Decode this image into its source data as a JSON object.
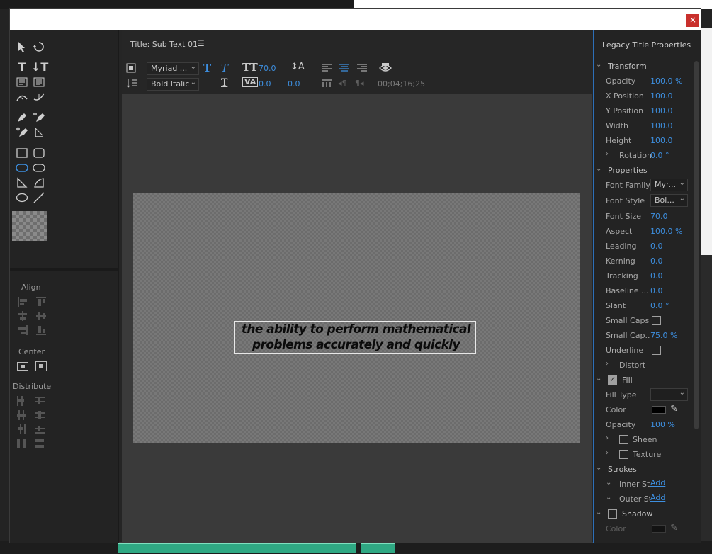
{
  "window": {
    "close_label": "×"
  },
  "main": {
    "title": "Title: Sub Text 01",
    "menu_icon": "hamburger-menu-icon",
    "toolbar": {
      "font_family": "Myriad ...",
      "font_style": "Bold Italic",
      "font_size": "70.0",
      "kerning": "0.0",
      "leading": "0.0",
      "timecode": "00;04;16;25"
    },
    "caption_lines": [
      "the ability to perform mathematical",
      "problems accurately and quickly"
    ]
  },
  "align_panel": {
    "align_label": "Align",
    "center_label": "Center",
    "distribute_label": "Distribute"
  },
  "properties": {
    "panel_title": "Legacy Title Properties",
    "transform": {
      "label": "Transform",
      "opacity": {
        "label": "Opacity",
        "value": "100.0",
        "unit": "%"
      },
      "x_position": {
        "label": "X Position",
        "value": "100.0"
      },
      "y_position": {
        "label": "Y Position",
        "value": "100.0"
      },
      "width": {
        "label": "Width",
        "value": "100.0"
      },
      "height": {
        "label": "Height",
        "value": "100.0"
      },
      "rotation": {
        "label": "Rotation",
        "value": "0.0 °"
      }
    },
    "props": {
      "label": "Properties",
      "font_family": {
        "label": "Font Family",
        "value": "Myr..."
      },
      "font_style": {
        "label": "Font Style",
        "value": "Bol..."
      },
      "font_size": {
        "label": "Font Size",
        "value": "70.0"
      },
      "aspect": {
        "label": "Aspect",
        "value": "100.0",
        "unit": "%"
      },
      "leading": {
        "label": "Leading",
        "value": "0.0"
      },
      "kerning": {
        "label": "Kerning",
        "value": "0.0"
      },
      "tracking": {
        "label": "Tracking",
        "value": "0.0"
      },
      "baseline": {
        "label": "Baseline ...",
        "value": "0.0"
      },
      "slant": {
        "label": "Slant",
        "value": "0.0 °"
      },
      "small_caps": {
        "label": "Small Caps"
      },
      "small_caps_size": {
        "label": "Small Cap...",
        "value": "75.0",
        "unit": "%"
      },
      "underline": {
        "label": "Underline"
      },
      "distort": {
        "label": "Distort"
      }
    },
    "fill": {
      "label": "Fill",
      "fill_type": {
        "label": "Fill Type",
        "value": ""
      },
      "color": {
        "label": "Color",
        "value": "#000000"
      },
      "opacity": {
        "label": "Opacity",
        "value": "100",
        "unit": "%"
      },
      "sheen": {
        "label": "Sheen"
      },
      "texture": {
        "label": "Texture"
      }
    },
    "strokes": {
      "label": "Strokes",
      "inner": {
        "label": "Inner Stro...",
        "add": "Add"
      },
      "outer": {
        "label": "Outer Str...",
        "add": "Add"
      }
    },
    "shadow": {
      "label": "Shadow",
      "color": {
        "label": "Color"
      }
    }
  },
  "colors": {
    "accent": "#3d8fe0",
    "close": "#c9302c",
    "clip": "#2fa883"
  }
}
